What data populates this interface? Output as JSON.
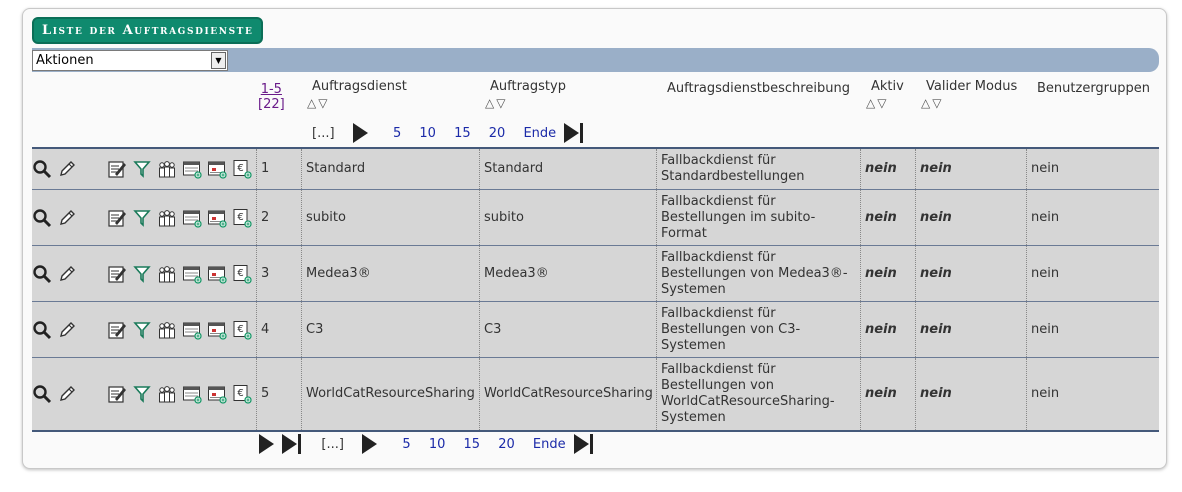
{
  "title": "Liste der Auftragsdienste",
  "actions_select": {
    "value": "Aktionen"
  },
  "columns": {
    "range": "1-5",
    "total": "[22]",
    "dienst": "Auftragsdienst",
    "typ": "Auftragstyp",
    "beschreibung": "Auftragsdienstbeschreibung",
    "aktiv": "Aktiv",
    "valider_modus": "Valider Modus",
    "benutzergruppen": "Benutzergruppen"
  },
  "sort_arrows": "△▽",
  "pager": {
    "ellipsis": "[...]",
    "pages": [
      "5",
      "10",
      "15",
      "20"
    ],
    "end": "Ende"
  },
  "rows": [
    {
      "num": "1",
      "dienst": "Standard",
      "typ": "Standard",
      "desc": "Fallbackdienst für Standardbestellungen",
      "aktiv": "nein",
      "valid": "nein",
      "group": "nein"
    },
    {
      "num": "2",
      "dienst": "subito",
      "typ": "subito",
      "desc": "Fallbackdienst für Bestellungen im subito-Format",
      "aktiv": "nein",
      "valid": "nein",
      "group": "nein"
    },
    {
      "num": "3",
      "dienst": "Medea3®",
      "typ": "Medea3®",
      "desc": "Fallbackdienst für Bestellungen von Medea3®-Systemen",
      "aktiv": "nein",
      "valid": "nein",
      "group": "nein"
    },
    {
      "num": "4",
      "dienst": "C3",
      "typ": "C3",
      "desc": "Fallbackdienst für Bestellungen von C3-Systemen",
      "aktiv": "nein",
      "valid": "nein",
      "group": "nein"
    },
    {
      "num": "5",
      "dienst": "WorldCatResourceSharing",
      "typ": "WorldCatResourceSharing",
      "desc": "Fallbackdienst für Bestellungen von WorldCatResourceSharing-Systemen",
      "aktiv": "nein",
      "valid": "nein",
      "group": "nein"
    }
  ],
  "icons": [
    "magnifier-icon",
    "pencil-icon",
    "edit-list-icon",
    "filter-icon",
    "user-group-icon",
    "calendar-add-icon",
    "calendar-date-icon",
    "currency-euro-icon"
  ],
  "colors": {
    "title_bg": "#0f8a6e",
    "bar_bg": "#9aafc8",
    "row_bg": "#d6d6d6",
    "link": "#1b2aa8"
  }
}
